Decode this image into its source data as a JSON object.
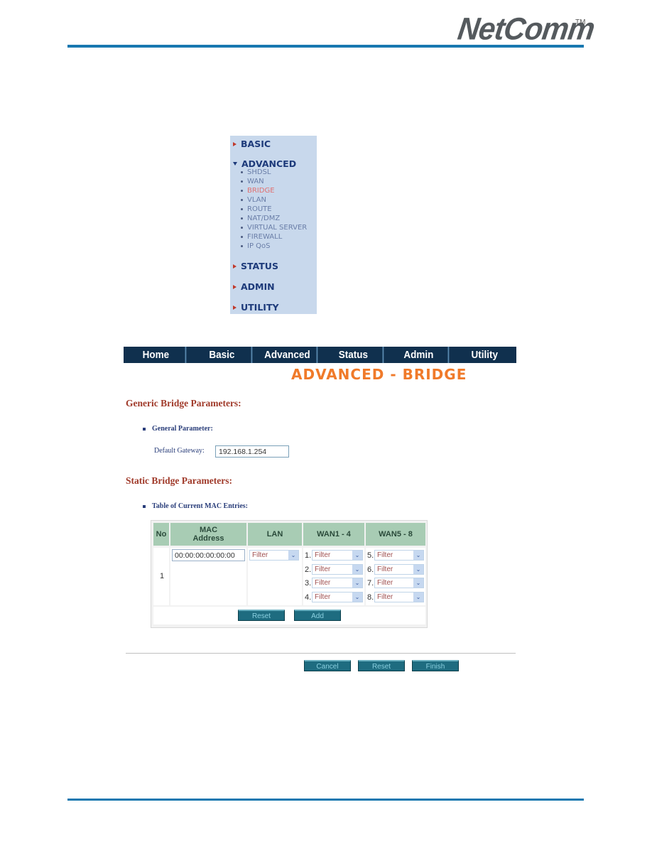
{
  "header": {
    "brand": "NetComm",
    "trademark": "TM"
  },
  "side_menu": {
    "sections": [
      {
        "label": "BASIC",
        "expanded": false
      },
      {
        "label": "ADVANCED",
        "expanded": true
      },
      {
        "label": "STATUS",
        "expanded": false
      },
      {
        "label": "ADMIN",
        "expanded": false
      },
      {
        "label": "UTILITY",
        "expanded": false
      }
    ],
    "advanced_items": [
      {
        "label": "SHDSL"
      },
      {
        "label": "WAN"
      },
      {
        "label": "BRIDGE",
        "active": true
      },
      {
        "label": "VLAN"
      },
      {
        "label": "ROUTE"
      },
      {
        "label": "NAT/DMZ"
      },
      {
        "label": "VIRTUAL SERVER"
      },
      {
        "label": "FIREWALL"
      },
      {
        "label": "IP QoS"
      }
    ]
  },
  "navbar": {
    "tabs": [
      {
        "label": "Home"
      },
      {
        "label": "Basic"
      },
      {
        "label": "Advanced"
      },
      {
        "label": "Status"
      },
      {
        "label": "Admin"
      },
      {
        "label": "Utility"
      }
    ]
  },
  "page": {
    "title": "ADVANCED - BRIDGE",
    "generic_section": "Generic Bridge Parameters:",
    "general_parameter": "General Parameter:",
    "default_gateway_label": "Default Gateway:",
    "default_gateway_value": "192.168.1.254",
    "static_section": "Static Bridge Parameters:",
    "mac_table_label": "Table of Current MAC Entries:"
  },
  "mac_table": {
    "headers": {
      "no": "No",
      "mac": "MAC Address",
      "lan": "LAN",
      "wan1": "WAN1 - 4",
      "wan5": "WAN5 - 8"
    },
    "row": {
      "no": "1",
      "mac": "00:00:00:00:00:00",
      "lan": "Filter",
      "wan1_4": [
        {
          "n": "1.",
          "value": "Filter"
        },
        {
          "n": "2.",
          "value": "Filter"
        },
        {
          "n": "3.",
          "value": "Filter"
        },
        {
          "n": "4.",
          "value": "Filter"
        }
      ],
      "wan5_8": [
        {
          "n": "5.",
          "value": "Filter"
        },
        {
          "n": "6.",
          "value": "Filter"
        },
        {
          "n": "7.",
          "value": "Filter"
        },
        {
          "n": "8.",
          "value": "Filter"
        }
      ]
    },
    "reset_label": "Reset",
    "add_label": "Add"
  },
  "footer_buttons": {
    "cancel": "Cancel",
    "reset": "Reset",
    "finish": "Finish"
  }
}
